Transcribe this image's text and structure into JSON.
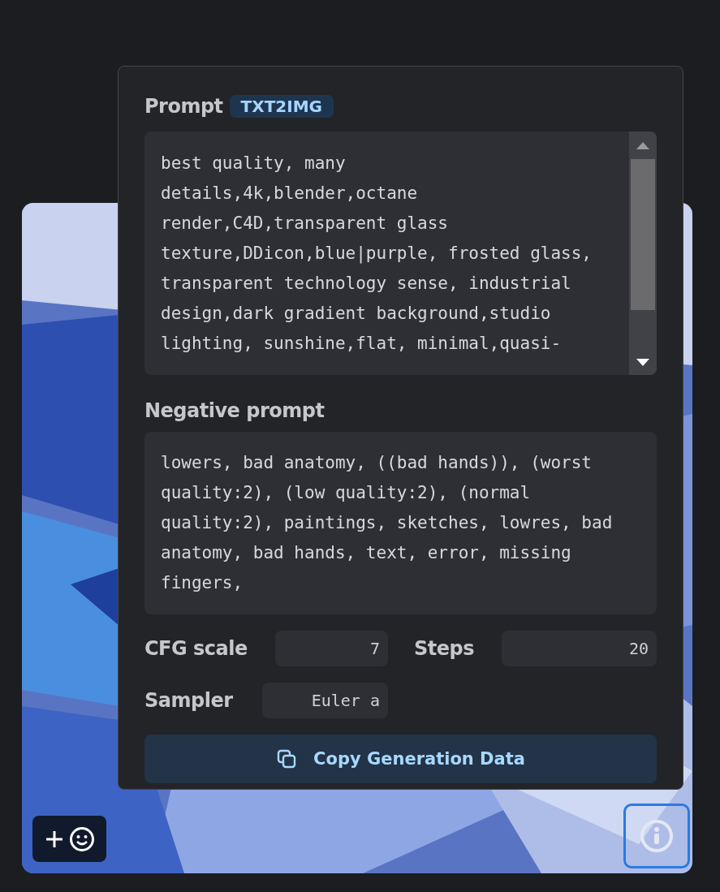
{
  "info_popover": {
    "prompt_label": "Prompt",
    "mode_badge": "TXT2IMG",
    "prompt": "best quality, many details,4k,blender,octane render,C4D,transparent glass texture,DDicon,blue|purple, frosted glass, transparent technology sense, industrial design,dark gradient background,studio lighting, sunshine,flat, minimal,quasi-",
    "negative_label": "Negative prompt",
    "negative_prompt": "lowers, bad anatomy, ((bad hands)), (worst quality:2), (low quality:2), (normal quality:2), paintings, sketches, lowres, bad anatomy, bad hands, text, error, missing fingers,",
    "params": [
      {
        "label": "CFG scale",
        "value": "7"
      },
      {
        "label": "Steps",
        "value": "20"
      },
      {
        "label": "Sampler",
        "value": "Euler a"
      }
    ],
    "copy_button": "Copy Generation Data"
  },
  "info_button": {
    "selected": true
  }
}
